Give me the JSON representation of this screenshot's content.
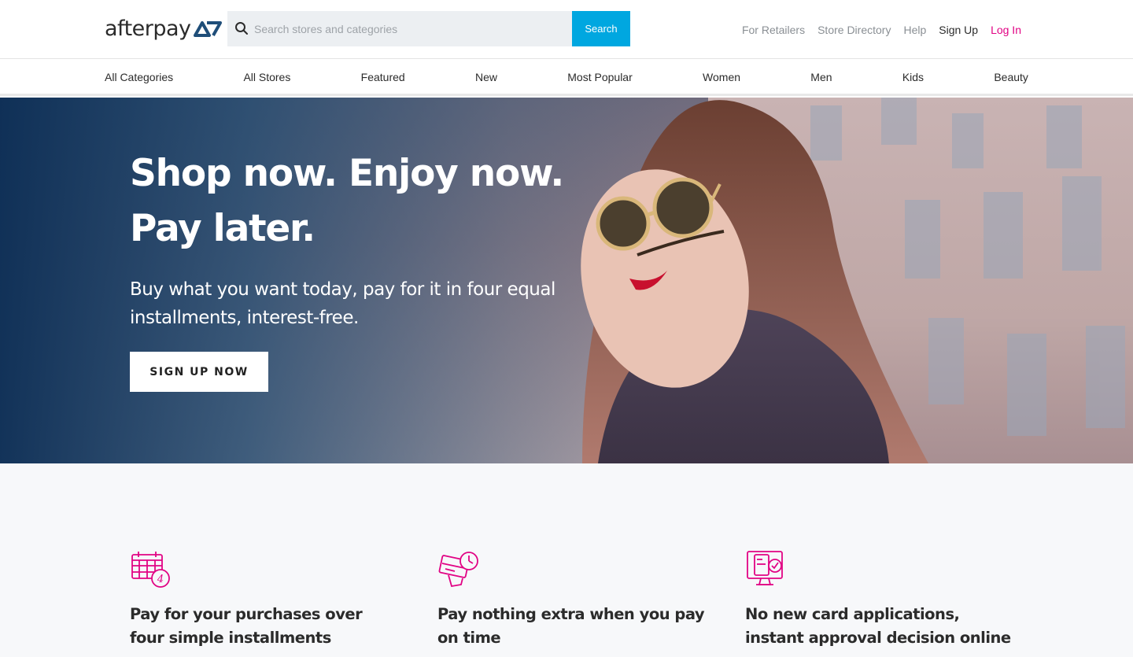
{
  "brand": {
    "name": "afterpay"
  },
  "search": {
    "placeholder": "Search stores and categories",
    "button_label": "Search"
  },
  "top_links": [
    {
      "label": "For Retailers"
    },
    {
      "label": "Store Directory"
    },
    {
      "label": "Help"
    },
    {
      "label": "Sign Up"
    },
    {
      "label": "Log In"
    }
  ],
  "categories": [
    {
      "label": "All Categories"
    },
    {
      "label": "All Stores"
    },
    {
      "label": "Featured"
    },
    {
      "label": "New"
    },
    {
      "label": "Most Popular"
    },
    {
      "label": "Women"
    },
    {
      "label": "Men"
    },
    {
      "label": "Kids"
    },
    {
      "label": "Beauty"
    }
  ],
  "hero": {
    "title_line1": "Shop now. Enjoy now.",
    "title_line2": "Pay later.",
    "subtitle": "Buy what you want today, pay for it in four equal installments, interest-free.",
    "cta": "SIGN UP NOW"
  },
  "features": [
    {
      "icon": "calendar-icon",
      "title": "Pay for your purchases over four simple installments",
      "badge": "4"
    },
    {
      "icon": "credit-card-clock-icon",
      "title": "Pay nothing extra when you pay on time"
    },
    {
      "icon": "approval-device-icon",
      "title": "No new card applications, instant approval decision online"
    }
  ],
  "colors": {
    "accent_blue": "#00a7e0",
    "accent_pink": "#e10384"
  }
}
